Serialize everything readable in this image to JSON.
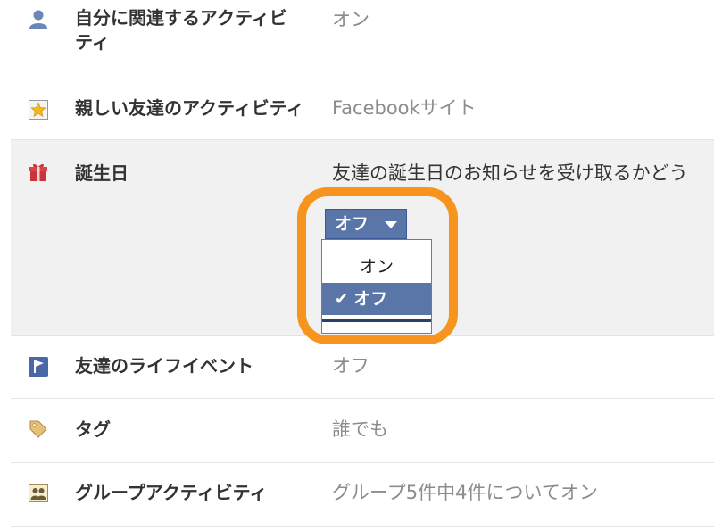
{
  "settings": [
    {
      "icon": "person-icon",
      "label_line1": "自分に関連するアクティビ",
      "label_line2": "ティ",
      "value": "オン"
    },
    {
      "icon": "star-icon",
      "label": "親しい友達のアクティビティ",
      "value": "Facebookサイト"
    },
    {
      "icon": "gift-icon",
      "label": "誕生日",
      "value": "友達の誕生日のお知らせを受け取るかどう"
    },
    {
      "icon": "life-event-flag-icon",
      "label": "友達のライフイベント",
      "value": "オフ"
    },
    {
      "icon": "tag-icon",
      "label": "タグ",
      "value": "誰でも"
    },
    {
      "icon": "group-icon",
      "label": "グループアクティビティ",
      "value": "グループ5件中4件についてオン"
    }
  ],
  "birthday_dropdown": {
    "selected": "オフ",
    "options": [
      {
        "label": "オン",
        "checked": false
      },
      {
        "label": "オフ",
        "checked": true,
        "check_mark": "✔"
      }
    ]
  },
  "colors": {
    "accent": "#5a75a8",
    "highlight": "#f7941e",
    "row_highlight_bg": "#f1f1f1",
    "value_gray": "#8c8c8c"
  }
}
